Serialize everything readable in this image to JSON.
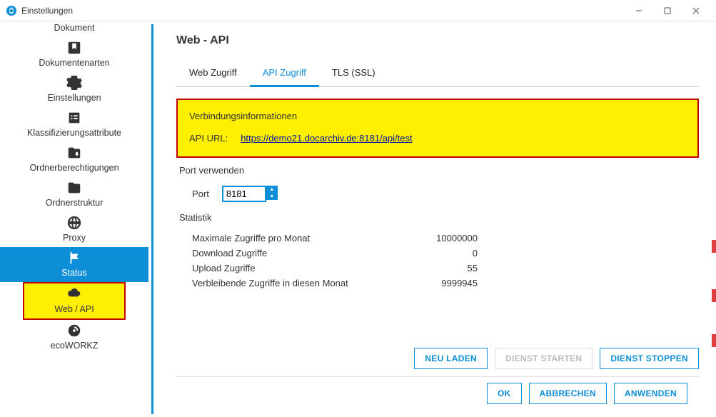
{
  "window": {
    "title": "Einstellungen"
  },
  "sidebar": {
    "items": [
      {
        "label": "Dokument",
        "icon": "document"
      },
      {
        "label": "Dokumentenarten",
        "icon": "bookmark"
      },
      {
        "label": "Einstellungen",
        "icon": "gear"
      },
      {
        "label": "Klassifizierungsattribute",
        "icon": "list"
      },
      {
        "label": "Ordnerberechtigungen",
        "icon": "folder-lock"
      },
      {
        "label": "Ordnerstruktur",
        "icon": "folder"
      },
      {
        "label": "Proxy",
        "icon": "globe"
      },
      {
        "label": "Status",
        "icon": "flag"
      },
      {
        "label": "Web / API",
        "icon": "cloud"
      },
      {
        "label": "ecoWORKZ",
        "icon": "auto"
      }
    ]
  },
  "main": {
    "title": "Web - API",
    "tabs": [
      {
        "label": "Web Zugriff"
      },
      {
        "label": "API Zugriff"
      },
      {
        "label": "TLS (SSL)"
      }
    ],
    "connection_section": {
      "title": "Verbindungsinformationen",
      "url_label": "API URL:",
      "url_value": "https://demo21.docarchiv.de:8181/api/test"
    },
    "port_section": {
      "title": "Port verwenden",
      "port_label": "Port",
      "port_value": "8181"
    },
    "stats_section": {
      "title": "Statistik",
      "rows": [
        {
          "label": "Maximale Zugriffe pro Monat",
          "value": "10000000"
        },
        {
          "label": "Download Zugriffe",
          "value": "0"
        },
        {
          "label": "Upload Zugriffe",
          "value": "55"
        },
        {
          "label": "Verbleibende Zugriffe in diesen Monat",
          "value": "9999945"
        }
      ]
    },
    "service_buttons": {
      "reload": "NEU LADEN",
      "start": "DIENST STARTEN",
      "stop": "DIENST STOPPEN"
    }
  },
  "footer": {
    "ok": "OK",
    "cancel": "ABBRECHEN",
    "apply": "ANWENDEN"
  }
}
